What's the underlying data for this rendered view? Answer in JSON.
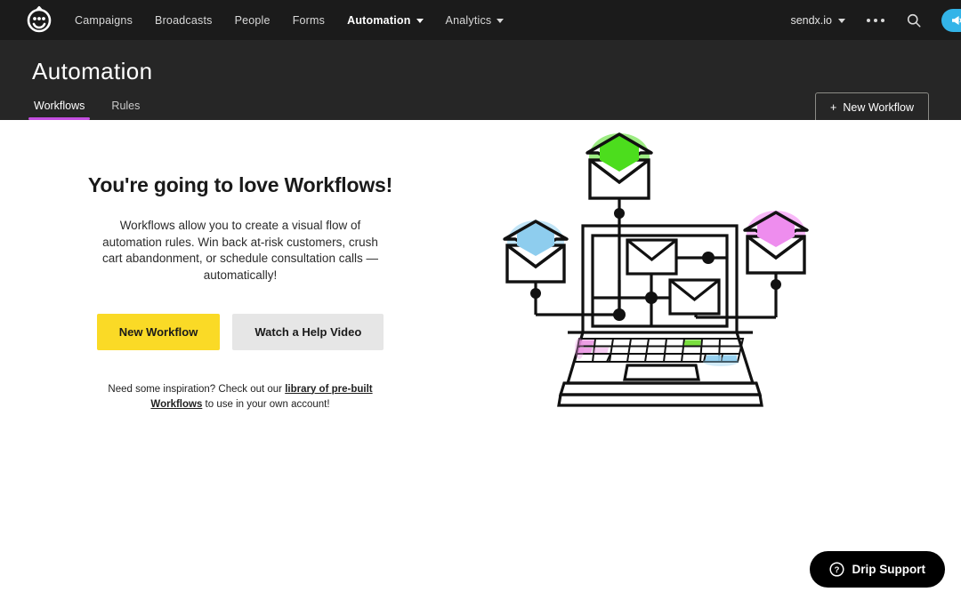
{
  "topnav": {
    "logo_icon": "drip-smiley-logo",
    "links": [
      {
        "label": "Campaigns",
        "has_caret": false,
        "active": false
      },
      {
        "label": "Broadcasts",
        "has_caret": false,
        "active": false
      },
      {
        "label": "People",
        "has_caret": false,
        "active": false
      },
      {
        "label": "Forms",
        "has_caret": false,
        "active": false
      },
      {
        "label": "Automation",
        "has_caret": true,
        "active": true
      },
      {
        "label": "Analytics",
        "has_caret": true,
        "active": false
      }
    ],
    "account": "sendx.io",
    "more_icon": "three-dots-icon",
    "search_icon": "search-icon",
    "announce_icon": "megaphone-icon",
    "accent_blue": "#33b4e8"
  },
  "pagehead": {
    "title": "Automation",
    "tabs": [
      {
        "label": "Workflows",
        "active": true
      },
      {
        "label": "Rules",
        "active": false
      }
    ],
    "new_workflow_label": "New Workflow",
    "plus_icon": "plus-icon",
    "tab_underline_color": "#c44fe0"
  },
  "hero": {
    "title": "You're going to love Workflows!",
    "body": "Workflows allow you to create a visual flow of automation rules. Win back at-risk customers, crush cart abandonment, or schedule consultation calls — automatically!",
    "primary_button": "New Workflow",
    "secondary_button": "Watch a Help Video",
    "primary_color": "#fada26",
    "secondary_color": "#e6e6e6",
    "inspiration_prefix": "Need some inspiration? Check out our ",
    "inspiration_link": "library of pre-built Workflows",
    "inspiration_suffix": " to use in your own account!"
  },
  "illustration": {
    "name": "workflow-laptop-envelopes-illustration",
    "envelope_top_color": "#4cdd1d",
    "envelope_left_color": "#8ecdee",
    "envelope_right_color": "#ee8dee",
    "key_pink": "#e98fe0",
    "key_green": "#6cdb2a",
    "key_blue": "#8ecdee"
  },
  "support": {
    "label": "Drip Support",
    "icon": "question-circle-icon"
  }
}
